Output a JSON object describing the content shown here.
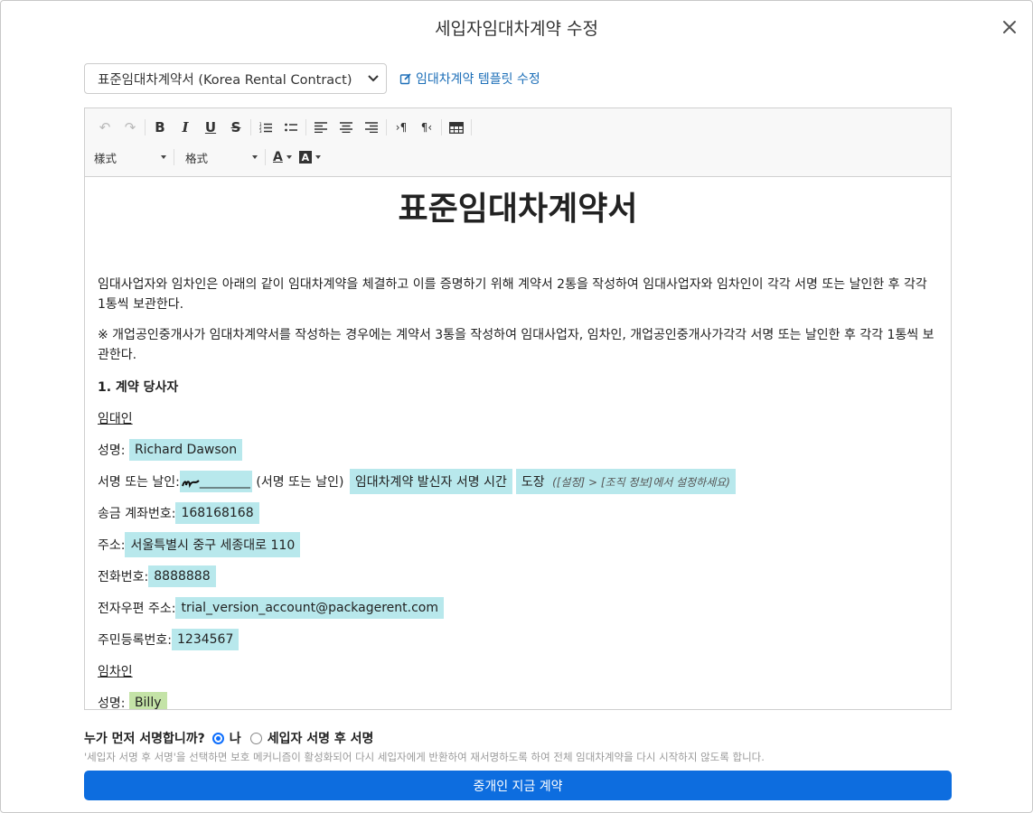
{
  "modal": {
    "title": "세입자임대차계약 수정"
  },
  "template": {
    "selected": "표준임대차계약서 (Korea Rental Contract)",
    "edit_link": "임대차계약 템플릿 수정"
  },
  "toolbar": {
    "style_label": "樣式",
    "format_label": "格式"
  },
  "document": {
    "title": "표준임대차계약서",
    "intro": "임대사업자와 임차인은 아래의 같이 임대차계약을 체결하고 이를 증명하기 위해 계약서 2통을 작성하여 임대사업자와 임차인이 각각 서명 또는 날인한 후 각각 1통씩 보관한다.",
    "note": "※ 개업공인중개사가 임대차계약서를 작성하는 경우에는 계약서 3통을 작성하여 임대사업자, 임차인, 개업공인중개사가각각 서명 또는 날인한 후 각각 1통씩 보관한다.",
    "section1": "1. 계약 당사자",
    "landlord_heading": "임대인",
    "name_label": "성명:",
    "landlord_name": "Richard Dawson",
    "sig_label": "서명 또는 날인:",
    "sig_blank": "________",
    "sig_suffix": "(서명 또는 날인)",
    "sig_time": "임대차계약 발신자 서명 시간",
    "stamp": "도장",
    "stamp_note": "([설정] > [조직 정보]에서 설정하세요)",
    "account_label": "송금 계좌번호:",
    "account": "168168168",
    "address_label": "주소:",
    "address": "서울특별시 중구 세종대로 110",
    "phone_label": "전화번호:",
    "phone": "8888888",
    "email_label": "전자우편 주소:",
    "email": "trial_version_account@packagerent.com",
    "rrn_label": "주민등록번호:",
    "rrn": "1234567",
    "tenant_heading": "임차인",
    "tenant_name_label": "성명:",
    "tenant_name": "Billy"
  },
  "signing": {
    "question": "누가 먼저 서명합니까?",
    "opt_me": "나",
    "opt_after": "세입자 서명 후 서명",
    "selected": "나",
    "help": "'세입자 서명 후 서명'을 선택하면 보호 메커니즘이 활성화되어 다시 세입자에게 반환하여 재서명하도록 하여 전체 임대차계약을 다시 시작하지 않도록 합니다."
  },
  "submit_label": "중개인 지금 계약",
  "colors": {
    "accent": "#0d6ddf",
    "highlight": "#b8e8ec",
    "tenant_highlight": "#c4e3a7",
    "link": "#1d6fb8"
  }
}
